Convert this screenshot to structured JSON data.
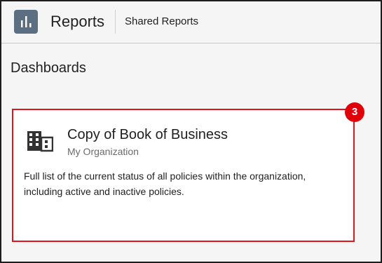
{
  "header": {
    "app_icon": "bar-chart-icon",
    "title": "Reports",
    "link": "Shared Reports"
  },
  "main": {
    "section_title": "Dashboards",
    "card": {
      "icon": "building-icon",
      "title": "Copy of Book of Business",
      "subtitle": "My Organization",
      "description": "Full list of the current status of all policies within the organization, including active and inactive policies."
    },
    "badge": "3"
  },
  "colors": {
    "header_bg": "#f5f5f5",
    "app_icon_bg": "#5c6f82",
    "highlight": "#e0141e"
  }
}
